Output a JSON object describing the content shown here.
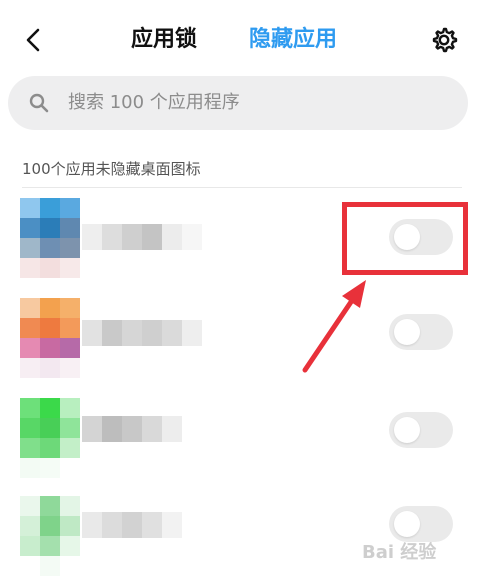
{
  "header": {
    "back_icon": "chevron-left-icon",
    "tab_lock_label": "应用锁",
    "tab_hide_label": "隐藏应用",
    "settings_icon": "gear-icon",
    "active_tab_color": "#2e9bf0"
  },
  "search": {
    "icon": "search-icon",
    "placeholder": "搜索 100 个应用程序"
  },
  "section": {
    "title": "100个应用未隐藏桌面图标"
  },
  "apps": [
    {
      "icon": "pixelated-app-icon",
      "toggle_on": false
    },
    {
      "icon": "pixelated-app-icon",
      "toggle_on": false
    },
    {
      "icon": "pixelated-app-icon",
      "toggle_on": false
    },
    {
      "icon": "pixelated-app-icon",
      "toggle_on": false
    }
  ],
  "annotation": {
    "highlight_color": "#e8313a"
  },
  "watermark": "Bai 经验"
}
